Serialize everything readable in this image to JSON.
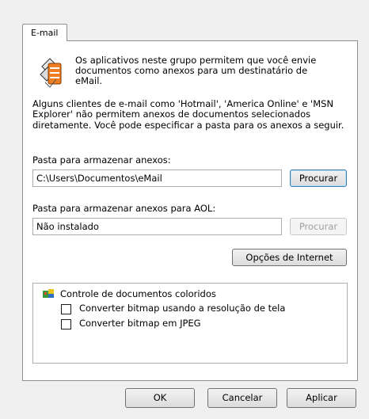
{
  "tab": {
    "label": "E-mail"
  },
  "intro_text": "Os aplicativos neste grupo permitem que você envie documentos como anexos para um destinatário de eMail.",
  "info_text": "Alguns clientes de e-mail como 'Hotmail', 'America Online' e 'MSN Explorer' não permitem anexos de documentos selecionados diretamente. Você pode especificar a pasta para os anexos a seguir.",
  "attachments_folder": {
    "label": "Pasta para armazenar anexos:",
    "value": "C:\\Users\\Documentos\\eMail",
    "browse_label": "Procurar"
  },
  "aol_folder": {
    "label": "Pasta para armazenar anexos para AOL:",
    "value": "Não instalado",
    "browse_label": "Procurar"
  },
  "internet_options_label": "Opções de Internet",
  "color_docs": {
    "title": "Controle de documentos coloridos",
    "options": [
      {
        "label": "Converter bitmap usando a resolução de tela",
        "checked": false
      },
      {
        "label": "Converter bitmap em JPEG",
        "checked": false
      }
    ]
  },
  "buttons": {
    "ok": "OK",
    "cancel": "Cancelar",
    "apply": "Aplicar"
  }
}
